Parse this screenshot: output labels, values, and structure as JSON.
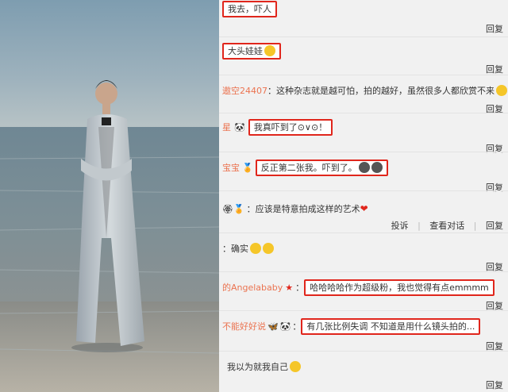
{
  "comments": [
    {
      "user": "",
      "sep": "",
      "text": "我去，吓人",
      "reply": "回复"
    },
    {
      "user": "",
      "sep": "",
      "text": "大头娃娃",
      "reply": "回复"
    },
    {
      "user": "遨空24407",
      "sep": "：",
      "text": "这种杂志就是越可怕，拍的越好，虽然很多人都欣赏不来",
      "reply": "回复"
    },
    {
      "user": "星",
      "sep": "",
      "text": "我真吓到了⊙∨⊙！",
      "reply": "回复"
    },
    {
      "user": "宝宝",
      "sep": "：",
      "text": "反正第二张我。吓到了。",
      "reply": "回复"
    },
    {
      "user": "",
      "sep": "：",
      "text": "应该是特意拍成这样的艺术",
      "reply": "回复"
    },
    {
      "user": "",
      "sep": "：",
      "text": "确实",
      "reply": "回复"
    },
    {
      "user": "的Angelababy",
      "sep": "：",
      "text": "哈哈哈哈作为超级粉，我也觉得有点emmmm",
      "reply": "回复"
    },
    {
      "user": "不能好好说",
      "sep": "：",
      "text": "有几张比例失调 不知道是用什么镜头拍的...",
      "reply": "回复"
    },
    {
      "user": "",
      "sep": "",
      "text": "我以为就我自己",
      "reply": "回复"
    }
  ],
  "actions": {
    "report": "投诉",
    "view_conversation": "查看对话",
    "reply": "回复"
  },
  "colors": {
    "highlight": "#e0261c",
    "username": "#eb7350",
    "panel_bg": "#f1f1f1"
  },
  "photo": {
    "description_icon": "photo-of-woman-on-beach"
  }
}
